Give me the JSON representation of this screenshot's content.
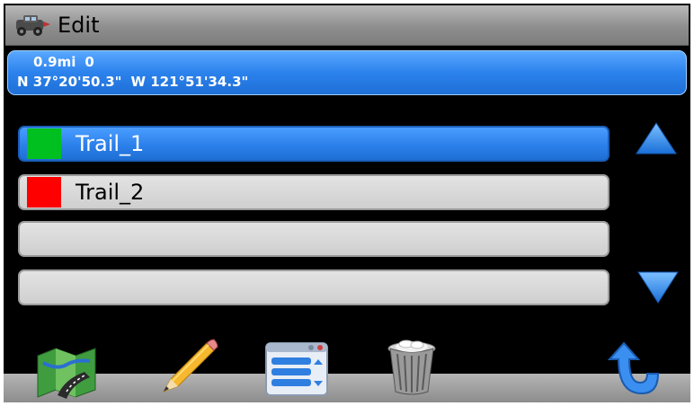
{
  "title_bar": {
    "title": "Edit",
    "icon": "vehicle-icon"
  },
  "position": {
    "distance": "0.9mi",
    "heading": "0",
    "latitude": "N 37°20'50.3\"",
    "longitude": "W 121°51'34.3\""
  },
  "trails": [
    {
      "name": "Trail_1",
      "color": "#00c020",
      "selected": true
    },
    {
      "name": "Trail_2",
      "color": "#ff0000",
      "selected": false
    },
    {
      "name": "",
      "color": "",
      "selected": false
    },
    {
      "name": "",
      "color": "",
      "selected": false
    }
  ],
  "scroll": {
    "up_icon": "triangle-up-icon",
    "down_icon": "triangle-down-icon"
  },
  "toolbar": {
    "items": [
      "map-icon",
      "pencil-icon",
      "list-icon",
      "trash-icon",
      "back-arrow-icon"
    ]
  },
  "colors": {
    "accent_blue": "#2c80ea",
    "item_gray": "#d8d8d8",
    "frame": "#000000"
  }
}
